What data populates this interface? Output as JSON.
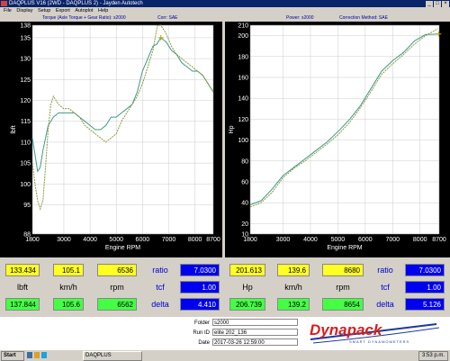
{
  "window": {
    "title": "DAQPLUS V16 (2WD - DAQPLUS 2) - Jayden Autotech",
    "buttons": [
      "_",
      "□",
      "×"
    ]
  },
  "menu": [
    "File",
    "Display",
    "Setup",
    "Export",
    "Autoplot",
    "Help"
  ],
  "left_chart": {
    "header": "Torque (Axle Torque + Gear Ratio): s2000",
    "corr": "Corr: SAE",
    "ylabel": "lbft",
    "xlabel": "Engine RPM",
    "yticks": [
      "88",
      "95",
      "100",
      "105",
      "110",
      "115",
      "120",
      "125",
      "130",
      "135",
      "138"
    ],
    "xticks": [
      "1800",
      "3000",
      "4000",
      "5000",
      "6000",
      "7000",
      "8000",
      "8700"
    ]
  },
  "right_chart": {
    "header": "Power: s2000",
    "corr": "Correction Method: SAE",
    "ylabel": "Hp",
    "xlabel": "Engine RPM",
    "yticks": [
      "10",
      "20",
      "40",
      "60",
      "80",
      "100",
      "120",
      "140",
      "160",
      "180",
      "200",
      "210"
    ],
    "xticks": [
      "1800",
      "3000",
      "4000",
      "5000",
      "6000",
      "7000",
      "8000",
      "8700"
    ]
  },
  "swatch_colors": [
    "#ff3030",
    "#30ff30",
    "#3050ff",
    "#ff50ff",
    "#30ffff",
    "#ff9030"
  ],
  "readouts": {
    "row1": [
      "133.434",
      "105.1",
      "6536",
      "201.613",
      "139.6",
      "8680"
    ],
    "labels": [
      "lbft",
      "km/h",
      "rpm",
      "Hp",
      "km/h",
      "rpm"
    ],
    "row3": [
      "137.844",
      "105.6",
      "6562",
      "206.739",
      "139.2",
      "8654"
    ],
    "left_side": {
      "ratio_label": "ratio",
      "ratio": "7.0300",
      "tcf_label": "tcf",
      "tcf": "1.00",
      "delta_label": "delta",
      "delta": "4.410"
    },
    "right_side": {
      "ratio_label": "ratio",
      "ratio": "7.0300",
      "tcf_label": "tcf",
      "tcf": "1.00",
      "delta_label": "delta",
      "delta": "5.126"
    }
  },
  "footer": {
    "folder_label": "Folder",
    "folder": "s2000",
    "runid_label": "Run ID",
    "runid": "elite  202_136",
    "date_label": "Date",
    "date": "2017-03-26  12:59:00",
    "logo": "Dynapack",
    "logo_sub": "SMART DYNAMOMETERS"
  },
  "taskbar": {
    "start": "Start",
    "app": "DAQPLUS",
    "clock": "3:53 p.m."
  },
  "chart_data": [
    {
      "type": "line",
      "title": "Torque (Axle Torque + Gear Ratio): s2000",
      "xlabel": "Engine RPM",
      "ylabel": "lbft",
      "xlim": [
        1800,
        8700
      ],
      "ylim": [
        88,
        138
      ],
      "series": [
        {
          "values_x": [
            1800,
            1900,
            2000,
            2100,
            2200,
            2400,
            2600,
            2800,
            3000,
            3200,
            3400,
            3600,
            3800,
            4000,
            4200,
            4400,
            4600,
            4800,
            5000,
            5200,
            5400,
            5600,
            5800,
            6000,
            6200,
            6400,
            6536,
            6700,
            6900,
            7100,
            7300,
            7500,
            7700,
            7900,
            8100,
            8300,
            8500,
            8700
          ],
          "values_y": [
            111,
            107,
            103,
            104,
            108,
            114,
            116,
            117,
            117,
            117,
            117,
            116,
            115,
            114,
            113,
            113,
            114,
            116,
            116,
            117,
            118,
            119,
            122,
            127,
            130,
            133,
            133.4,
            135,
            134,
            132,
            131,
            129,
            128,
            127,
            127,
            126,
            124,
            122
          ]
        },
        {
          "values_x": [
            1800,
            1900,
            2000,
            2100,
            2200,
            2300,
            2400,
            2500,
            2600,
            2800,
            3000,
            3200,
            3400,
            3600,
            3800,
            4000,
            4200,
            4400,
            4600,
            4800,
            5000,
            5200,
            5400,
            5600,
            5800,
            6000,
            6200,
            6400,
            6562,
            6700,
            6900,
            7100,
            7300,
            7500,
            7700,
            7900,
            8100,
            8300,
            8500,
            8700
          ],
          "values_y": [
            105,
            100,
            96,
            94,
            96,
            104,
            113,
            119,
            121,
            119,
            118,
            118,
            117,
            116,
            114,
            113,
            112,
            111,
            110,
            111,
            112,
            115,
            117,
            119,
            121,
            124,
            128,
            132,
            137.8,
            138,
            136,
            133,
            131,
            130,
            129,
            128,
            127,
            126,
            124,
            122
          ]
        }
      ]
    },
    {
      "type": "line",
      "title": "Power: s2000",
      "xlabel": "Engine RPM",
      "ylabel": "Hp",
      "xlim": [
        1800,
        8700
      ],
      "ylim": [
        10,
        210
      ],
      "series": [
        {
          "values_x": [
            1800,
            2200,
            2600,
            3000,
            3400,
            3800,
            4200,
            4600,
            5000,
            5400,
            5800,
            6200,
            6600,
            7000,
            7400,
            7800,
            8200,
            8680
          ],
          "values_y": [
            38,
            42,
            53,
            66,
            74,
            82,
            90,
            98,
            108,
            119,
            132,
            149,
            166,
            176,
            184,
            195,
            201,
            201.6
          ]
        },
        {
          "values_x": [
            1800,
            2200,
            2600,
            3000,
            3400,
            3800,
            4200,
            4600,
            5000,
            5400,
            5800,
            6200,
            6600,
            7000,
            7400,
            7800,
            8200,
            8654
          ],
          "values_y": [
            36,
            40,
            50,
            64,
            73,
            80,
            88,
            96,
            105,
            116,
            130,
            146,
            163,
            173,
            182,
            192,
            200,
            206.7
          ]
        }
      ]
    }
  ]
}
